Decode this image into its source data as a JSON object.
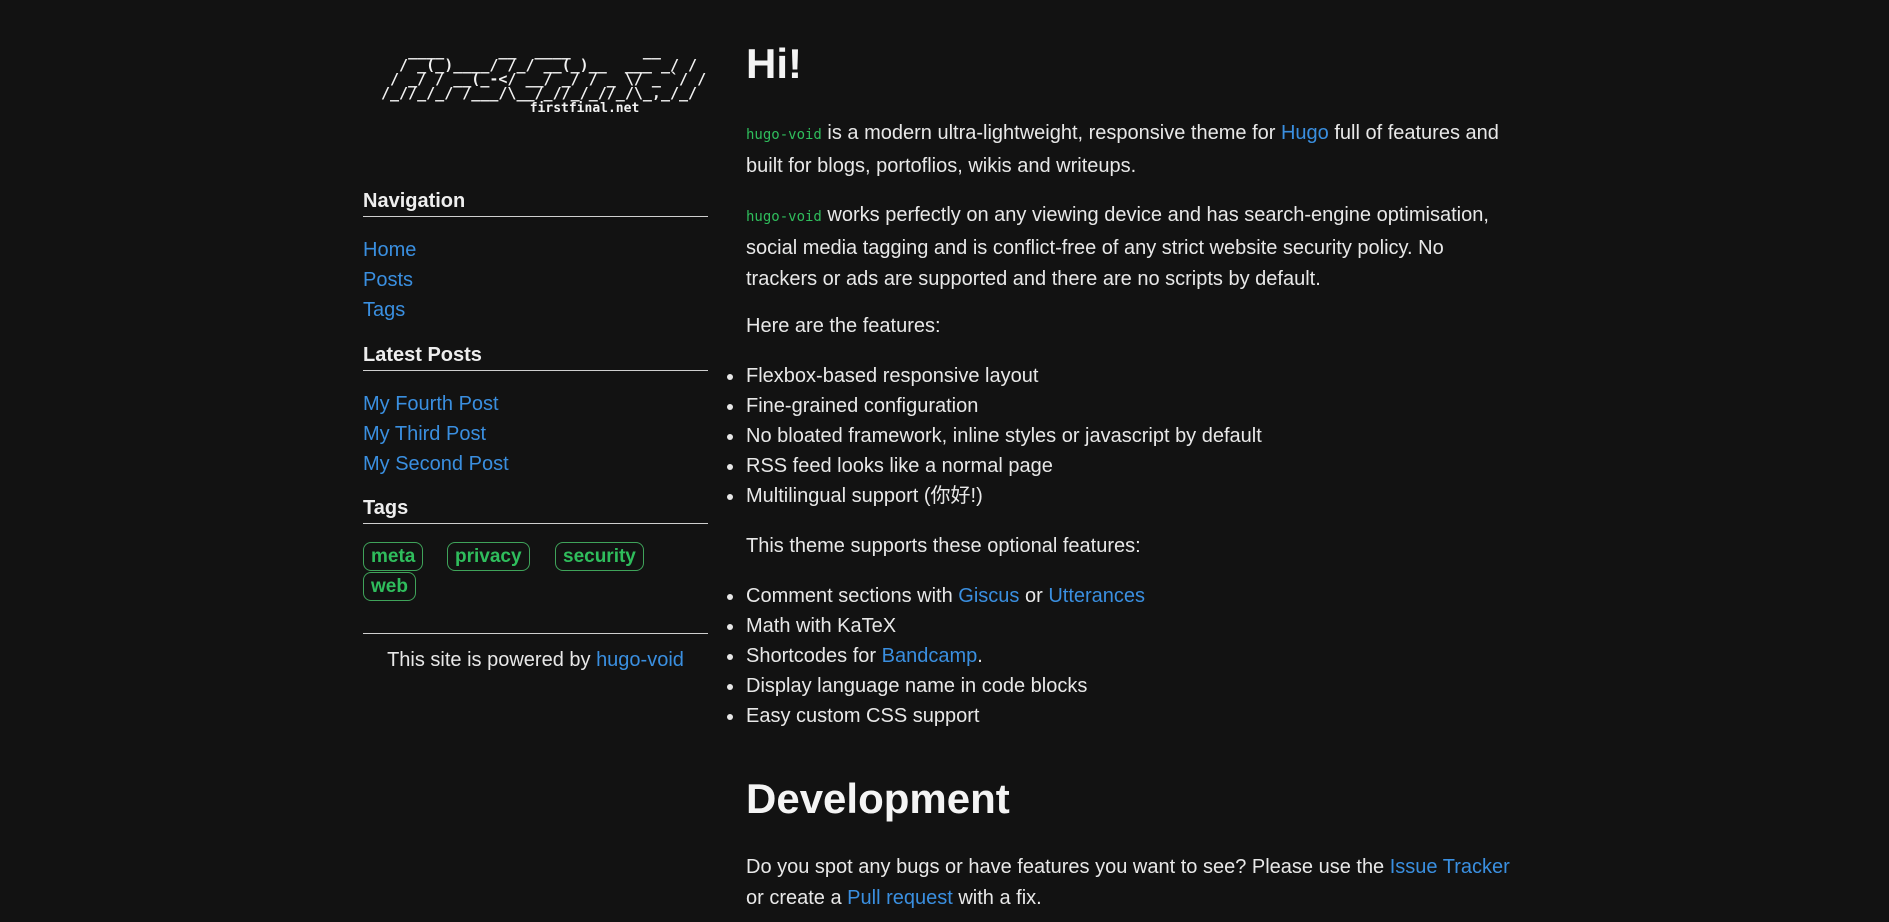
{
  "logo": {
    "ascii_lines": [
      "   ____      __  ____        __",
      "  / _(_)____/ /_/ __(_)__  ___ _/ /",
      " / _/ / __(_-</ __/ _/ / _ \\/ _ `/ /",
      "/_//_/_/ /___/\\__/_//_/_//_/\\_,_/_/"
    ],
    "domain": "firstfinal.net"
  },
  "sidebar": {
    "navigation": {
      "heading": "Navigation",
      "items": [
        {
          "label": "Home"
        },
        {
          "label": "Posts"
        },
        {
          "label": "Tags"
        }
      ]
    },
    "latest_posts": {
      "heading": "Latest Posts",
      "items": [
        {
          "label": "My Fourth Post"
        },
        {
          "label": "My Third Post"
        },
        {
          "label": "My Second Post"
        }
      ]
    },
    "tags": {
      "heading": "Tags",
      "items": [
        {
          "label": "meta"
        },
        {
          "label": "privacy"
        },
        {
          "label": "security"
        },
        {
          "label": "web"
        }
      ]
    },
    "footer": {
      "text": "This site is powered by ",
      "link": "hugo-void"
    }
  },
  "main": {
    "title": "Hi!",
    "intro": {
      "code": "hugo-void",
      "text_before_link": " is a modern ultra-lightweight, responsive theme for ",
      "link": "Hugo",
      "text_after_link": " full of features and built for blogs, portoflios, wikis and writeups."
    },
    "second": {
      "code": "hugo-void",
      "text": " works perfectly on any viewing device and has search-engine optimisation, social media tagging and is conflict-free of any strict website security policy. No trackers or ads are supported and there are no scripts by default."
    },
    "features_intro": "Here are the features:",
    "features": [
      "Flexbox-based responsive layout",
      "Fine-grained configuration",
      "No bloated framework, inline styles or javascript by default",
      "RSS feed looks like a normal page",
      "Multilingual support (你好!)"
    ],
    "optional_intro": "This theme supports these optional features:",
    "optional": {
      "comments_prefix": "Comment sections with ",
      "giscus": "Giscus",
      "or": " or ",
      "utterances": "Utterances",
      "math": "Math with KaTeX",
      "shortcodes_prefix": "Shortcodes for ",
      "bandcamp": "Bandcamp",
      "shortcodes_suffix": ".",
      "language": "Display language name in code blocks",
      "css": "Easy custom CSS support"
    },
    "development": {
      "heading": "Development",
      "text_1": "Do you spot any bugs or have features you want to see? Please use the ",
      "issue_link": "Issue Tracker",
      "text_2": " or create a ",
      "pr_link": "Pull request",
      "text_3": " with a fix."
    }
  }
}
